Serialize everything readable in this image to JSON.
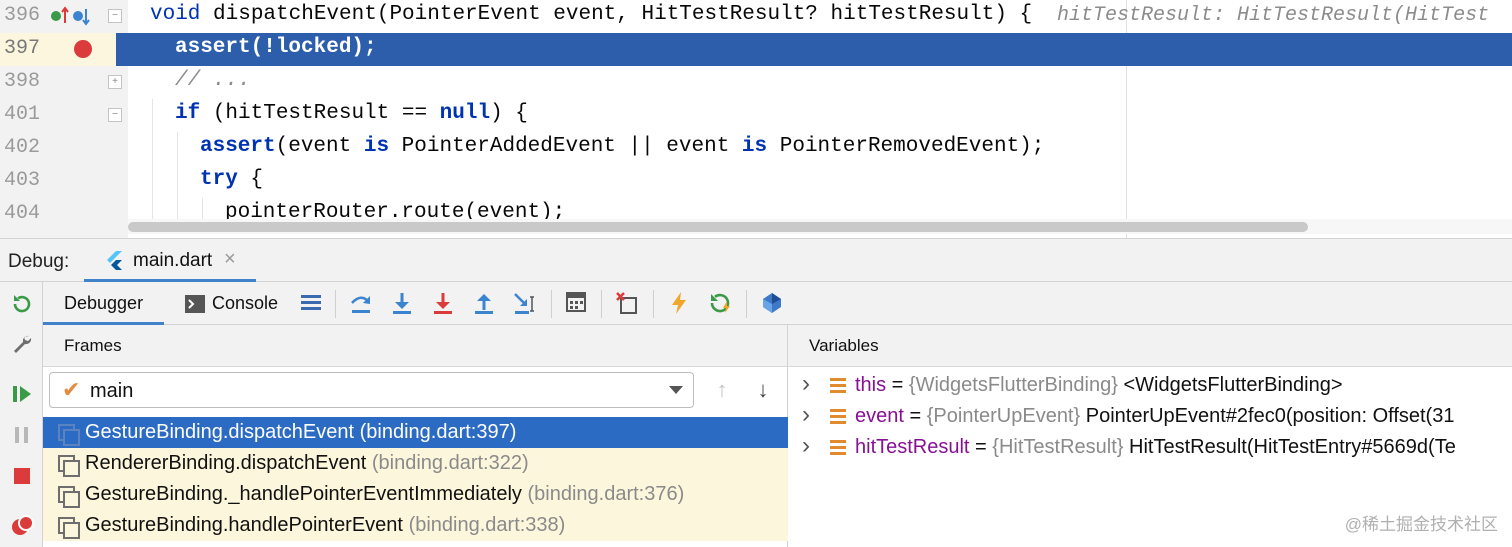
{
  "editor": {
    "lines": [
      {
        "num": "396",
        "code_parts": [
          [
            "kw2",
            "void "
          ],
          [
            "",
            "dispatchEvent(PointerEvent event, HitTestResult? hitTestResult) {"
          ]
        ],
        "inlay": "hitTestResult: HitTestResult(HitTest"
      },
      {
        "num": "397",
        "code_parts": [
          [
            "",
            "assert(!locked);"
          ]
        ],
        "highlighted": true
      },
      {
        "num": "398",
        "code_parts": [
          [
            "cm",
            "// ..."
          ]
        ]
      },
      {
        "num": "401",
        "code_parts": [
          [
            "kw",
            "if"
          ],
          [
            "",
            " (hitTestResult == "
          ],
          [
            "kw",
            "null"
          ],
          [
            "",
            ") {"
          ]
        ]
      },
      {
        "num": "402",
        "code_parts": [
          [
            "kw",
            "assert"
          ],
          [
            "",
            "(event "
          ],
          [
            "kw",
            "is"
          ],
          [
            "",
            " PointerAddedEvent || event "
          ],
          [
            "kw",
            "is"
          ],
          [
            "",
            " PointerRemovedEvent);"
          ]
        ]
      },
      {
        "num": "403",
        "code_parts": [
          [
            "kw",
            "try"
          ],
          [
            "",
            " {"
          ]
        ]
      },
      {
        "num": "404",
        "code_parts": [
          [
            "",
            "pointerRouter.route(event);"
          ]
        ]
      }
    ]
  },
  "debug": {
    "title": "Debug:",
    "tab_label": "main.dart",
    "tab_close": "×",
    "subtabs": {
      "debugger": "Debugger",
      "console": "Console"
    },
    "frames": {
      "header": "Frames",
      "thread": "main",
      "items": [
        {
          "method": "GestureBinding.dispatchEvent",
          "location": "(binding.dart:397)"
        },
        {
          "method": "RendererBinding.dispatchEvent",
          "location": "(binding.dart:322)"
        },
        {
          "method": "GestureBinding._handlePointerEventImmediately",
          "location": "(binding.dart:376)"
        },
        {
          "method": "GestureBinding.handlePointerEvent",
          "location": "(binding.dart:338)"
        }
      ]
    },
    "variables": {
      "header": "Variables",
      "items": [
        {
          "name": "this",
          "eq": " = ",
          "type": "{WidgetsFlutterBinding}",
          "value": " <WidgetsFlutterBinding>"
        },
        {
          "name": "event",
          "eq": " = ",
          "type": "{PointerUpEvent}",
          "value": " PointerUpEvent#2fec0(position: Offset(31"
        },
        {
          "name": "hitTestResult",
          "eq": " = ",
          "type": "{HitTestResult}",
          "value": " HitTestResult(HitTestEntry#5669d(Te"
        }
      ]
    },
    "watermark": "@稀土掘金技术社区"
  },
  "colors": {
    "selection": "#2c5eac",
    "frame_selected": "#2c6bc4",
    "frame_bg": "#fcf7dc",
    "breakpoint": "#db3b3b",
    "accent": "#4083c9"
  },
  "icons": [
    "rerun-icon",
    "wrench-icon",
    "resume-icon",
    "pause-icon",
    "stop-icon",
    "view-breakpoints-icon",
    "step-over-icon",
    "step-into-icon",
    "force-step-into-icon",
    "step-out-icon",
    "run-to-cursor-icon",
    "evaluate-icon",
    "drop-frame-icon",
    "hot-reload-icon",
    "hot-restart-icon",
    "devtools-icon"
  ]
}
